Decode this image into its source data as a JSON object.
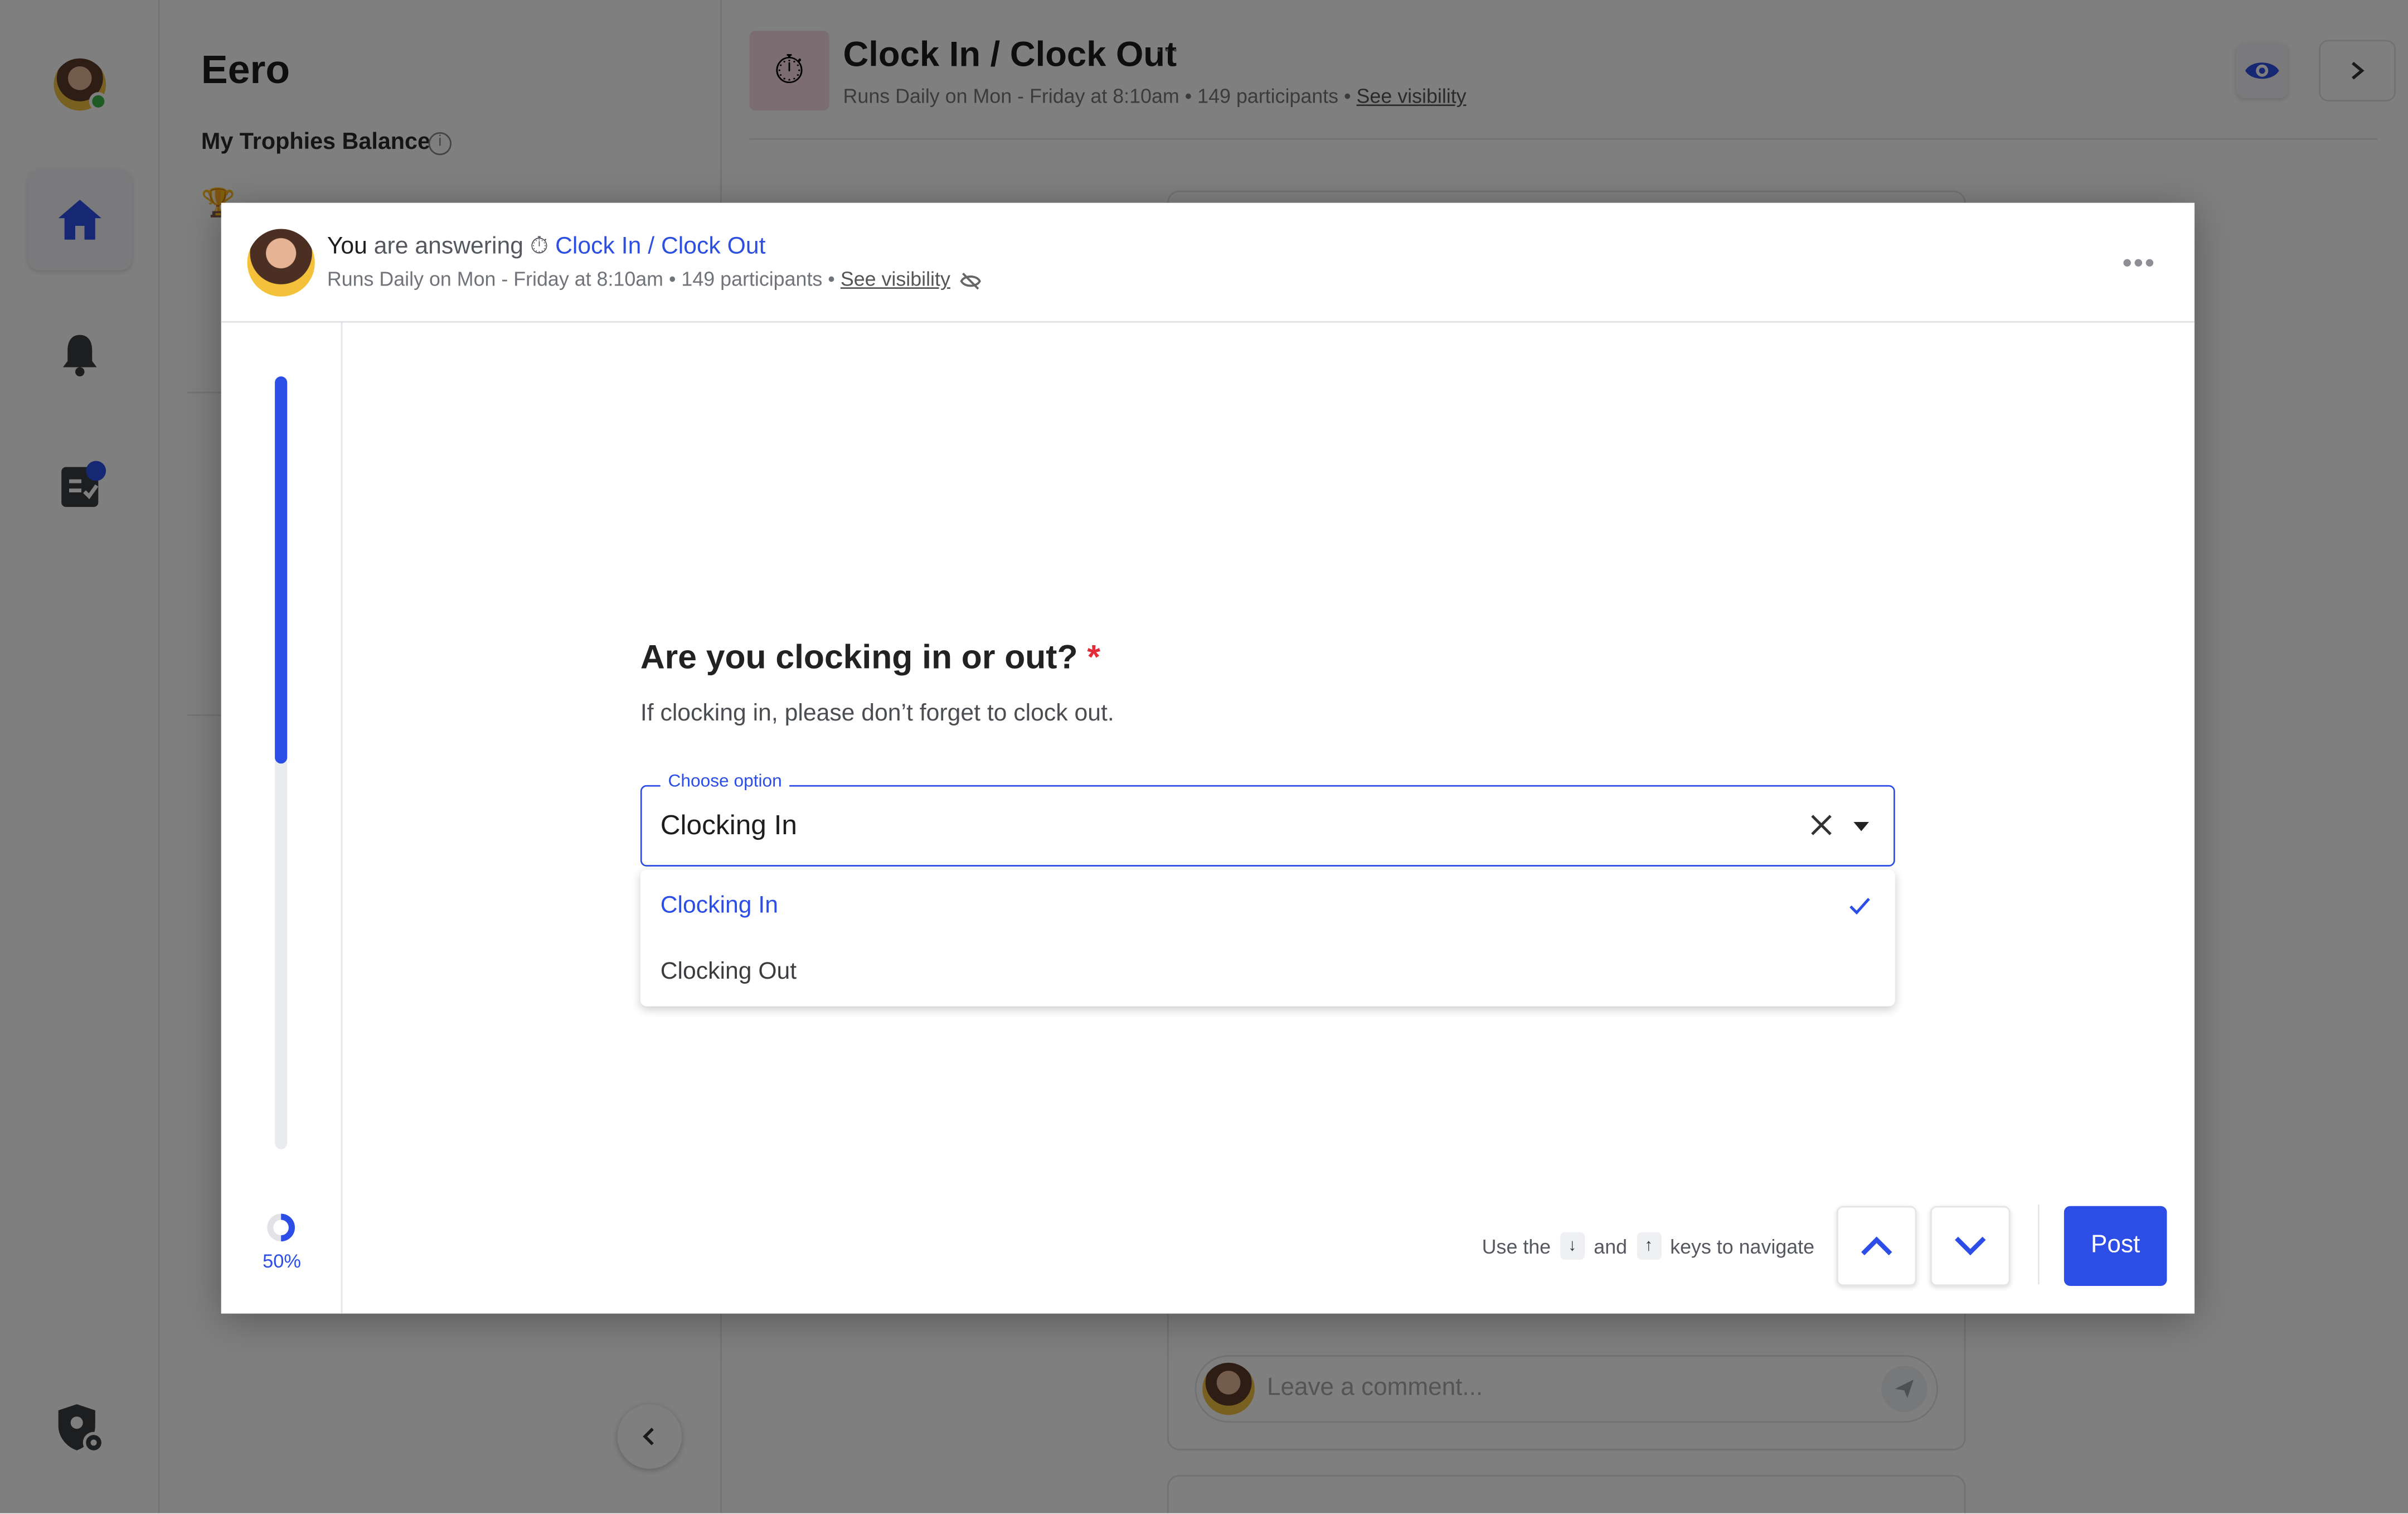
{
  "sidebar": {
    "workspace_title": "Eero",
    "balance_label": "My Trophies Balance"
  },
  "background": {
    "title": "Clock In / Clock Out",
    "subtitle": "Runs Daily on Mon - Friday at 8:10am • 149 participants •",
    "visibility_link": "See visibility",
    "comment_placeholder": "Leave a comment..."
  },
  "modal": {
    "user_label": "You",
    "answering_text": "are answering",
    "flow_icon": "⏱",
    "flow_title": "Clock In / Clock Out",
    "schedule": "Runs Daily on Mon - Friday at 8:10am • 149 participants •",
    "visibility_link": "See visibility",
    "more_label": "•••",
    "progress": {
      "percent_label": "50%",
      "fraction": 0.5
    },
    "question": {
      "title": "Are you clocking in or out?",
      "required_marker": "*",
      "description": "If clocking in, please don’t forget to clock out."
    },
    "select": {
      "label": "Choose option",
      "value": "Clocking In",
      "options": [
        {
          "label": "Clocking In",
          "selected": true
        },
        {
          "label": "Clocking Out",
          "selected": false
        }
      ]
    },
    "footer": {
      "hint_prefix": "Use the",
      "key_down": "↓",
      "hint_and": "and",
      "key_up": "↑",
      "hint_suffix": "keys to navigate",
      "post_label": "Post"
    }
  },
  "colors": {
    "accent": "#2c4ee6",
    "required": "#e32b3a"
  }
}
